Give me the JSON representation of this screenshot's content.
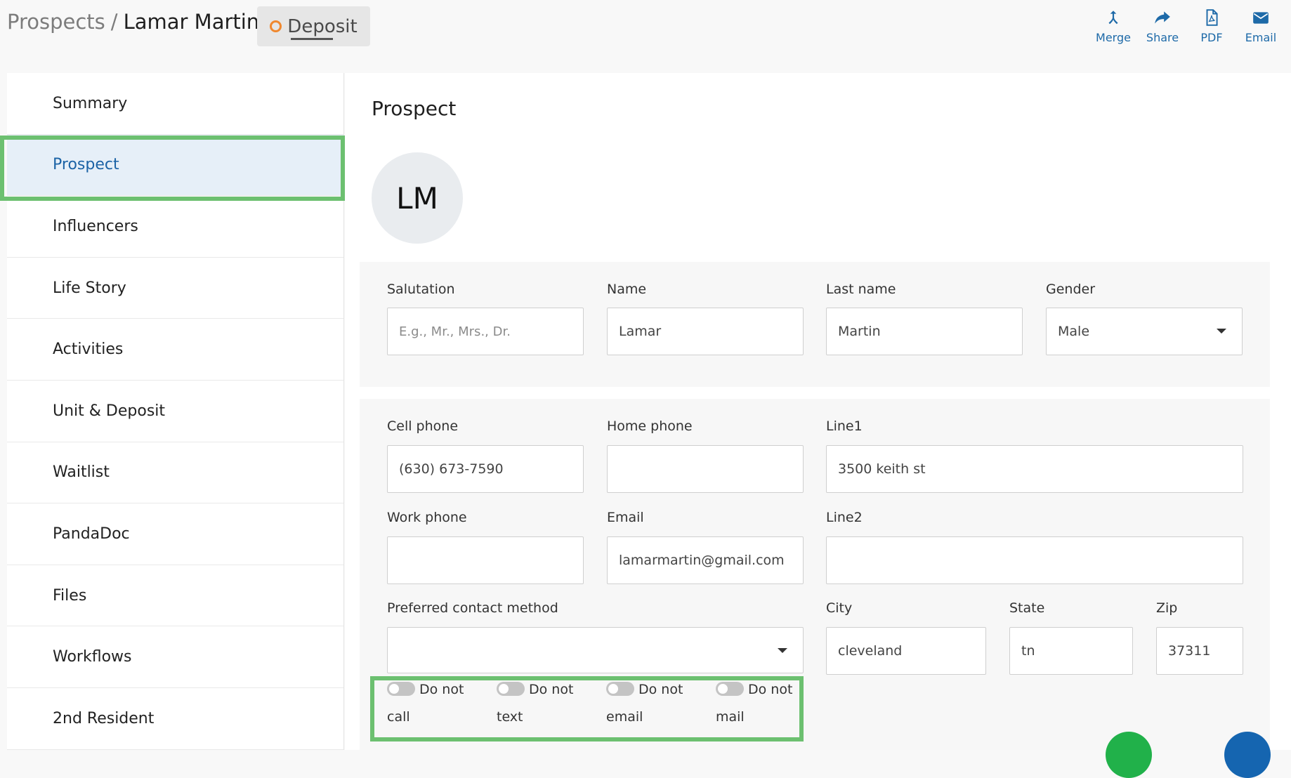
{
  "header": {
    "breadcrumb_root": "Prospects",
    "breadcrumb_separator": "/",
    "breadcrumb_current": "Lamar Martin",
    "status_label": "Deposit",
    "status_color": "#f0882f",
    "actions": [
      {
        "label": "Merge",
        "icon": "merge-icon"
      },
      {
        "label": "Share",
        "icon": "share-icon"
      },
      {
        "label": "PDF",
        "icon": "pdf-icon"
      },
      {
        "label": "Email",
        "icon": "email-icon"
      }
    ]
  },
  "sidebar": {
    "items": [
      {
        "label": "Summary"
      },
      {
        "label": "Prospect",
        "active": true
      },
      {
        "label": "Influencers"
      },
      {
        "label": "Life Story"
      },
      {
        "label": "Activities"
      },
      {
        "label": "Unit & Deposit"
      },
      {
        "label": "Waitlist"
      },
      {
        "label": "PandaDoc"
      },
      {
        "label": "Files"
      },
      {
        "label": "Workflows"
      },
      {
        "label": "2nd Resident"
      }
    ]
  },
  "main": {
    "title": "Prospect",
    "avatar_initials": "LM",
    "name_card": {
      "salutation": {
        "label": "Salutation",
        "value": "",
        "placeholder": "E.g., Mr., Mrs., Dr."
      },
      "name": {
        "label": "Name",
        "value": "Lamar"
      },
      "last_name": {
        "label": "Last name",
        "value": "Martin"
      },
      "gender": {
        "label": "Gender",
        "value": "Male"
      }
    },
    "contact_card": {
      "cell_phone": {
        "label": "Cell phone",
        "value": "(630) 673-7590"
      },
      "home_phone": {
        "label": "Home phone",
        "value": ""
      },
      "line1": {
        "label": "Line1",
        "value": "3500 keith st"
      },
      "work_phone": {
        "label": "Work phone",
        "value": ""
      },
      "email": {
        "label": "Email",
        "value": "lamarmartin@gmail.com"
      },
      "line2": {
        "label": "Line2",
        "value": ""
      },
      "preferred_contact": {
        "label": "Preferred contact method",
        "value": ""
      },
      "city": {
        "label": "City",
        "value": "cleveland"
      },
      "state": {
        "label": "State",
        "value": "tn"
      },
      "zip": {
        "label": "Zip",
        "value": "37311"
      },
      "toggles": [
        {
          "line1": "Do not",
          "line2": "call",
          "on": false
        },
        {
          "line1": "Do not",
          "line2": "text",
          "on": false
        },
        {
          "line1": "Do not",
          "line2": "email",
          "on": false
        },
        {
          "line1": "Do not",
          "line2": "mail",
          "on": false
        }
      ]
    }
  },
  "colors": {
    "accent": "#1e6aa8",
    "active_bg": "#e6eff8",
    "highlight": "#6cc070",
    "fab_green": "#21b14a",
    "fab_blue": "#1565b0"
  }
}
